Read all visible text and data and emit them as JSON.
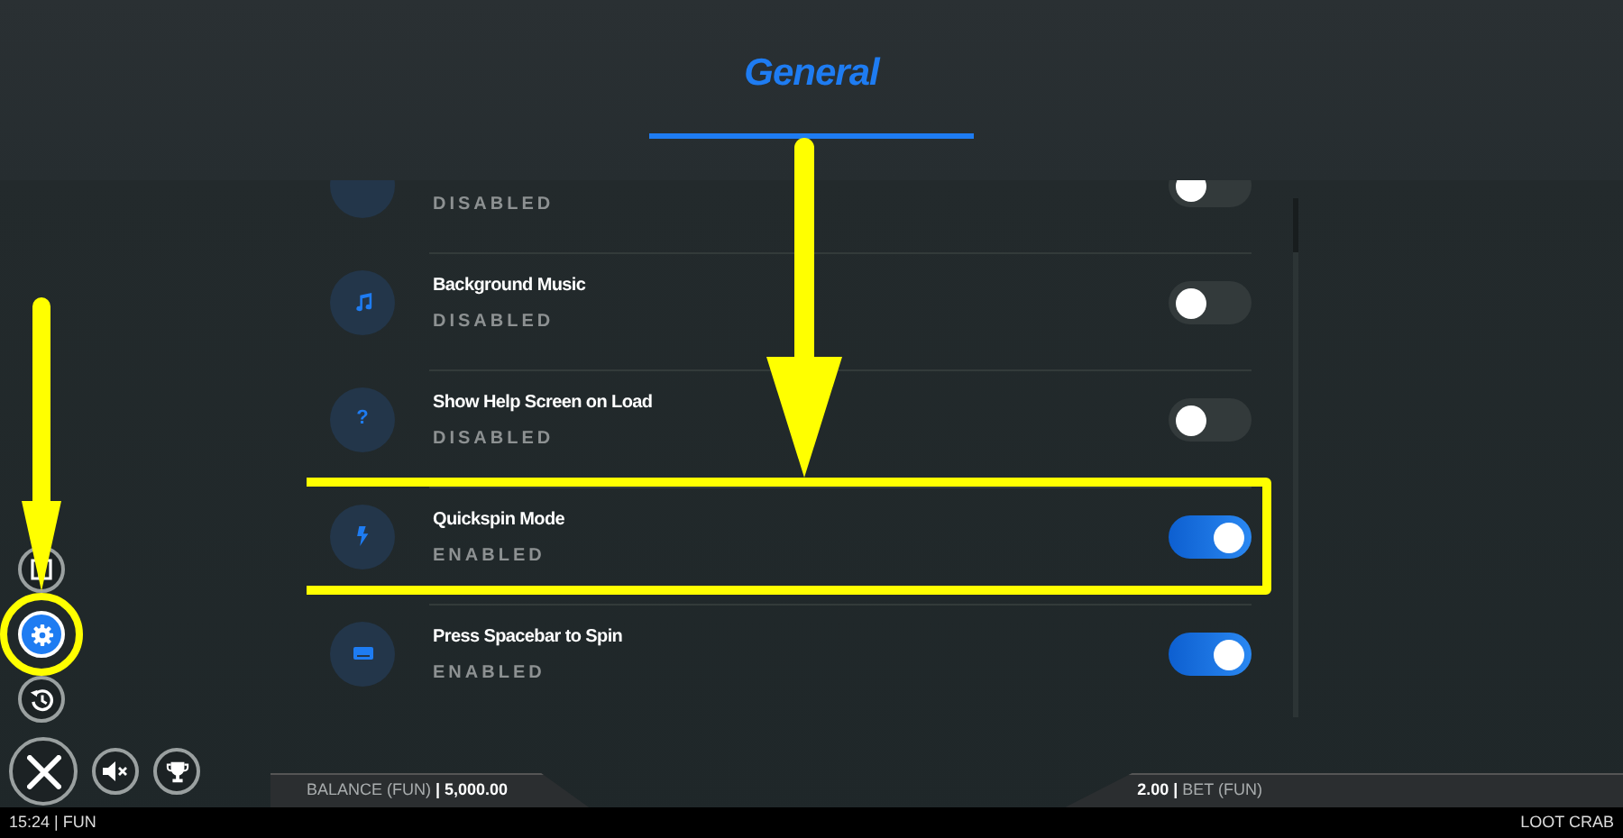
{
  "header": {
    "title": "General"
  },
  "settings": [
    {
      "status": "DISABLED",
      "on": false,
      "highlighted": false
    },
    {
      "label": "Background Music",
      "status": "DISABLED",
      "on": false,
      "highlighted": false
    },
    {
      "glyph": "?",
      "label": "Show Help Screen on Load",
      "status": "DISABLED",
      "on": false,
      "highlighted": false
    },
    {
      "label": "Quickspin Mode",
      "status": "ENABLED",
      "on": true,
      "highlighted": true
    },
    {
      "label": "Press Spacebar to Spin",
      "status": "ENABLED",
      "on": true,
      "highlighted": false
    }
  ],
  "side_buttons": [
    {
      "kind": "paytable",
      "selected": false,
      "highlighted": false
    },
    {
      "kind": "settings",
      "selected": true,
      "highlighted": true
    },
    {
      "kind": "history",
      "selected": false,
      "highlighted": false
    }
  ],
  "bottom_buttons": [
    {
      "kind": "close"
    },
    {
      "kind": "mute"
    },
    {
      "kind": "trophy"
    }
  ],
  "bet_bar": {
    "balance": "BALANCE (FUN) **|  5,000.00**",
    "bet": "**2.00 |** BET  (FUN)"
  },
  "status_bar": {
    "left": "15:24 | FUN",
    "right": "LOOT CRAB"
  }
}
